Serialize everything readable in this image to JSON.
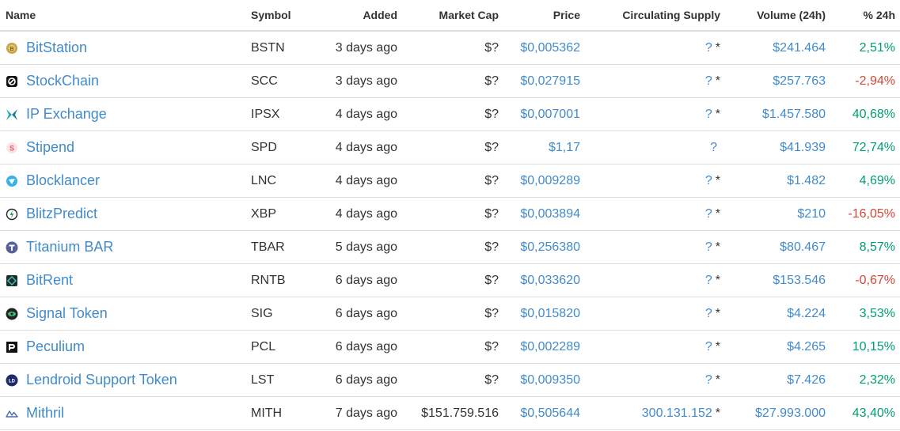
{
  "headers": {
    "name": "Name",
    "symbol": "Symbol",
    "added": "Added",
    "market_cap": "Market Cap",
    "price": "Price",
    "circulating_supply": "Circulating Supply",
    "volume": "Volume (24h)",
    "change": "% 24h"
  },
  "colors": {
    "link": "#428bca",
    "positive": "#009e73",
    "negative": "#d14836"
  },
  "rows": [
    {
      "icon": "bitstation-icon",
      "name": "BitStation",
      "symbol": "BSTN",
      "added": "3 days ago",
      "market_cap": "$?",
      "price": "$0,005362",
      "supply": "?",
      "supply_star": "*",
      "volume": "$241.464",
      "change": "2,51%"
    },
    {
      "icon": "stockchain-icon",
      "name": "StockChain",
      "symbol": "SCC",
      "added": "3 days ago",
      "market_cap": "$?",
      "price": "$0,027915",
      "supply": "?",
      "supply_star": "*",
      "volume": "$257.763",
      "change": "-2,94%"
    },
    {
      "icon": "ip-exchange-icon",
      "name": "IP Exchange",
      "symbol": "IPSX",
      "added": "4 days ago",
      "market_cap": "$?",
      "price": "$0,007001",
      "supply": "?",
      "supply_star": "*",
      "volume": "$1.457.580",
      "change": "40,68%"
    },
    {
      "icon": "stipend-icon",
      "name": "Stipend",
      "symbol": "SPD",
      "added": "4 days ago",
      "market_cap": "$?",
      "price": "$1,17",
      "supply": "?",
      "supply_star": "",
      "volume": "$41.939",
      "change": "72,74%"
    },
    {
      "icon": "blocklancer-icon",
      "name": "Blocklancer",
      "symbol": "LNC",
      "added": "4 days ago",
      "market_cap": "$?",
      "price": "$0,009289",
      "supply": "?",
      "supply_star": "*",
      "volume": "$1.482",
      "change": "4,69%"
    },
    {
      "icon": "blitzpredict-icon",
      "name": "BlitzPredict",
      "symbol": "XBP",
      "added": "4 days ago",
      "market_cap": "$?",
      "price": "$0,003894",
      "supply": "?",
      "supply_star": "*",
      "volume": "$210",
      "change": "-16,05%"
    },
    {
      "icon": "titanium-bar-icon",
      "name": "Titanium BAR",
      "symbol": "TBAR",
      "added": "5 days ago",
      "market_cap": "$?",
      "price": "$0,256380",
      "supply": "?",
      "supply_star": "*",
      "volume": "$80.467",
      "change": "8,57%"
    },
    {
      "icon": "bitrent-icon",
      "name": "BitRent",
      "symbol": "RNTB",
      "added": "6 days ago",
      "market_cap": "$?",
      "price": "$0,033620",
      "supply": "?",
      "supply_star": "*",
      "volume": "$153.546",
      "change": "-0,67%"
    },
    {
      "icon": "signal-token-icon",
      "name": "Signal Token",
      "symbol": "SIG",
      "added": "6 days ago",
      "market_cap": "$?",
      "price": "$0,015820",
      "supply": "?",
      "supply_star": "*",
      "volume": "$4.224",
      "change": "3,53%"
    },
    {
      "icon": "peculium-icon",
      "name": "Peculium",
      "symbol": "PCL",
      "added": "6 days ago",
      "market_cap": "$?",
      "price": "$0,002289",
      "supply": "?",
      "supply_star": "*",
      "volume": "$4.265",
      "change": "10,15%"
    },
    {
      "icon": "lendroid-icon",
      "name": "Lendroid Support Token",
      "symbol": "LST",
      "added": "6 days ago",
      "market_cap": "$?",
      "price": "$0,009350",
      "supply": "?",
      "supply_star": "*",
      "volume": "$7.426",
      "change": "2,32%"
    },
    {
      "icon": "mithril-icon",
      "name": "Mithril",
      "symbol": "MITH",
      "added": "7 days ago",
      "market_cap": "$151.759.516",
      "price": "$0,505644",
      "supply": "300.131.152",
      "supply_star": "*",
      "volume": "$27.993.000",
      "change": "43,40%"
    }
  ]
}
